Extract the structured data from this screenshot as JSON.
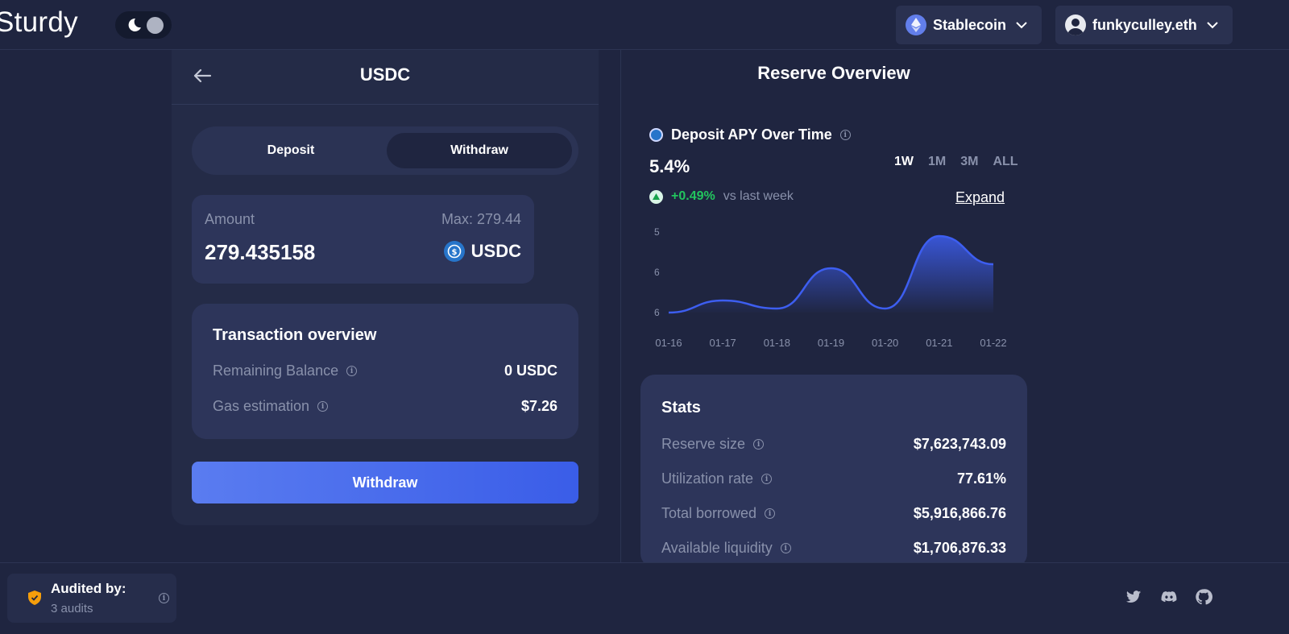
{
  "header": {
    "logo": "Sturdy",
    "network_label": "Stablecoin",
    "account_label": "funkyculley.eth"
  },
  "deposit_panel": {
    "asset_title": "USDC",
    "tabs": [
      {
        "label": "Deposit",
        "active": false
      },
      {
        "label": "Withdraw",
        "active": true
      }
    ],
    "amount_label": "Amount",
    "max_label": "Max:  279.44",
    "amount_value": "279.435158",
    "amount_asset": "USDC",
    "tx_overview": {
      "title": "Transaction overview",
      "rows": [
        {
          "label": "Remaining Balance",
          "value": "0 USDC"
        },
        {
          "label": "Gas estimation",
          "value": "$7.26"
        }
      ]
    },
    "submit_label": "Withdraw"
  },
  "reserve": {
    "title": "Reserve Overview",
    "chart_title": "Deposit APY Over Time",
    "apy_value": "5.4%",
    "ranges": [
      {
        "label": "1W",
        "active": true
      },
      {
        "label": "1M",
        "active": false
      },
      {
        "label": "3M",
        "active": false
      },
      {
        "label": "ALL",
        "active": false
      }
    ],
    "change_value": "+0.49%",
    "change_text": "vs last week",
    "expand_label": "Expand",
    "stats": {
      "title": "Stats",
      "rows": [
        {
          "label": "Reserve size",
          "value": "$7,623,743.09"
        },
        {
          "label": "Utilization rate",
          "value": "77.61%"
        },
        {
          "label": "Total borrowed",
          "value": "$5,916,866.76"
        },
        {
          "label": "Available liquidity",
          "value": "$1,706,876.33"
        }
      ]
    }
  },
  "chart_data": {
    "type": "area",
    "x": [
      "01-16",
      "01-17",
      "01-18",
      "01-19",
      "01-20",
      "01-21",
      "01-22"
    ],
    "y_ticks": [
      "5",
      "6",
      "6"
    ],
    "series": [
      {
        "values": [
          5.0,
          5.15,
          5.05,
          5.55,
          5.05,
          5.95,
          5.6
        ]
      }
    ],
    "ylim": [
      5,
      6
    ],
    "colors": {
      "line": "#3d5ef0",
      "fill_top": "#3d5ef0"
    }
  },
  "footer": {
    "audit_title": "Audited by:",
    "audit_sub": "3 audits",
    "social": [
      "twitter-icon",
      "discord-icon",
      "github-icon"
    ]
  },
  "colors": {
    "background": "#1f2540",
    "card": "#242b47",
    "panel": "#2d355a",
    "accent": "#3a5de8",
    "positive": "#22c55e",
    "muted": "#8991ab"
  }
}
